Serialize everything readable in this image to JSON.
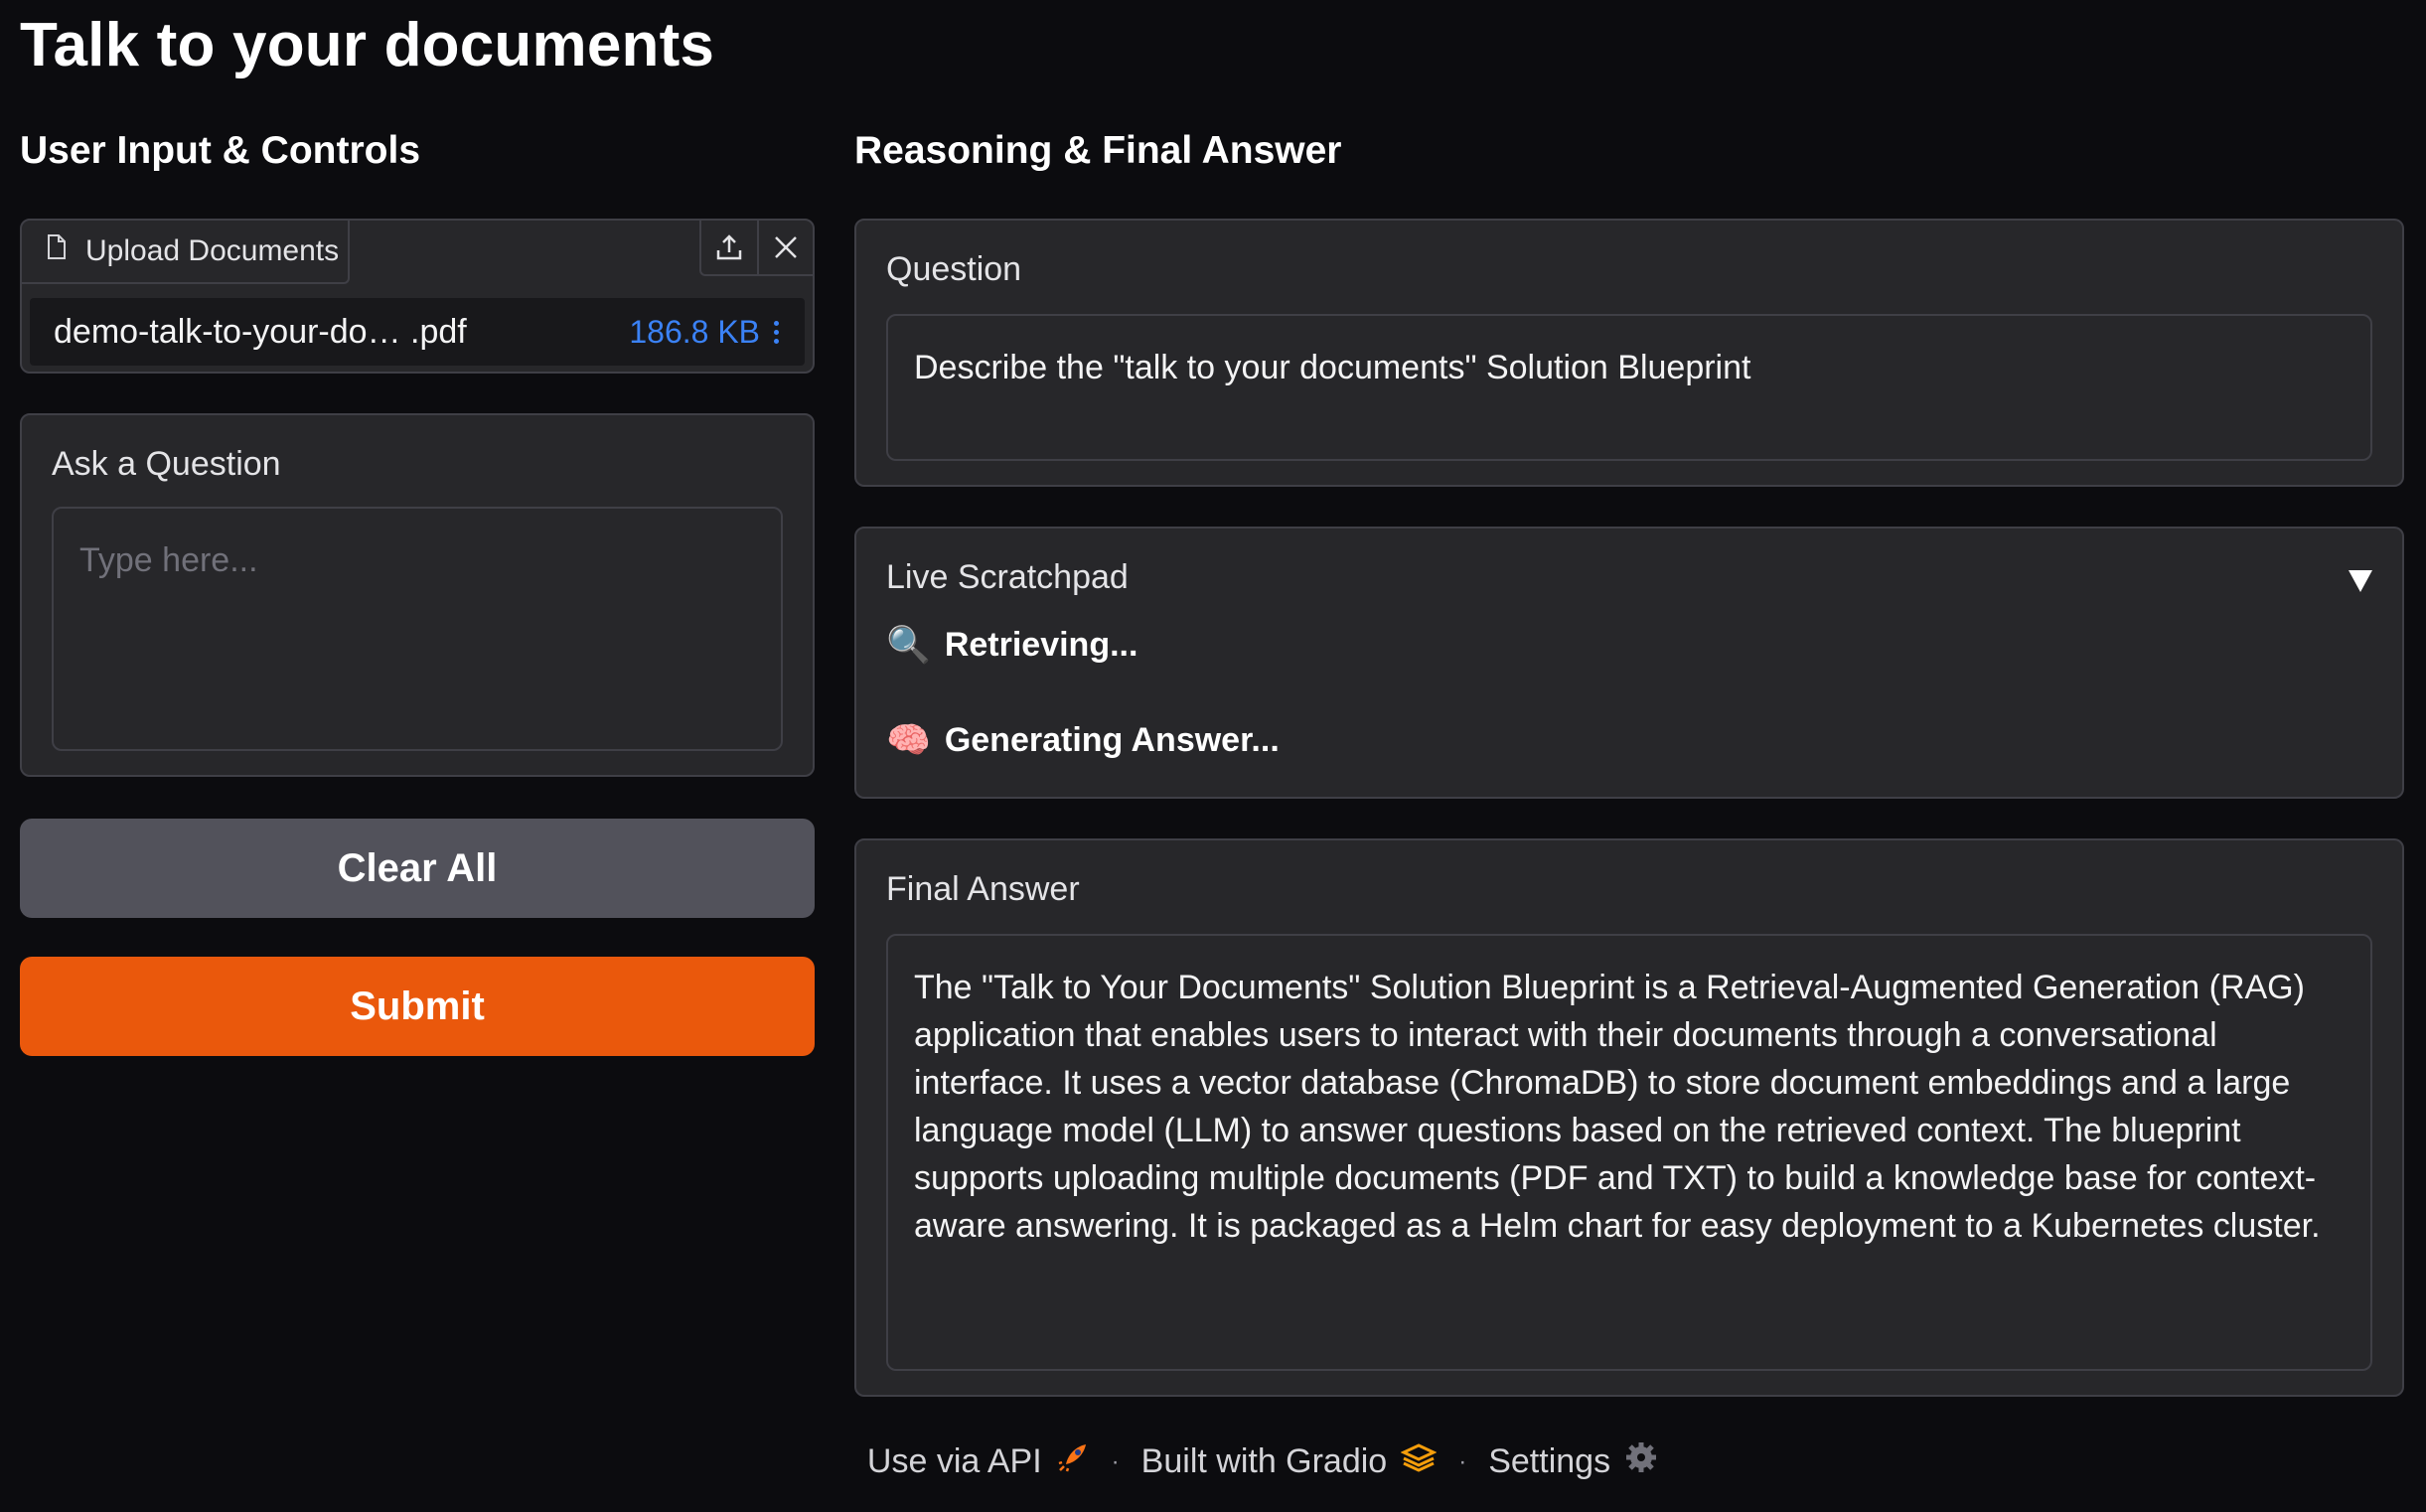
{
  "app": {
    "title": "Talk to your documents"
  },
  "left": {
    "heading": "User Input & Controls",
    "upload": {
      "label": "Upload Documents",
      "file_name": "demo-talk-to-your-do… .pdf",
      "file_size": "186.8 KB"
    },
    "question_box": {
      "label": "Ask a Question",
      "placeholder": "Type here..."
    },
    "clear_label": "Clear All",
    "submit_label": "Submit"
  },
  "right": {
    "heading": "Reasoning & Final Answer",
    "question": {
      "label": "Question",
      "value": "Describe the \"talk to your documents\" Solution Blueprint"
    },
    "scratchpad": {
      "label": "Live Scratchpad",
      "steps": [
        {
          "icon": "magnifier-icon",
          "glyph": "🔍",
          "text": "Retrieving..."
        },
        {
          "icon": "brain-icon",
          "glyph": "🧠",
          "text": "Generating Answer..."
        }
      ]
    },
    "answer": {
      "label": "Final Answer",
      "value": "The \"Talk to Your Documents\" Solution Blueprint is a Retrieval-Augmented Generation (RAG) application that enables users to interact with their documents through a conversational interface. It uses a vector database (ChromaDB) to store document embeddings and a large language model (LLM) to answer questions based on the retrieved context. The blueprint supports uploading multiple documents (PDF and TXT) to build a knowledge base for context-aware answering. It is packaged as a Helm chart for easy deployment to a Kubernetes cluster."
    }
  },
  "footer": {
    "api_label": "Use via API",
    "built_label": "Built with Gradio",
    "settings_label": "Settings",
    "separator": "·"
  },
  "colors": {
    "background": "#0c0c0f",
    "panel": "#27272a",
    "border": "#3f3f46",
    "submit": "#ea580c",
    "clear": "#52525b",
    "file_size": "#3b82f6"
  }
}
